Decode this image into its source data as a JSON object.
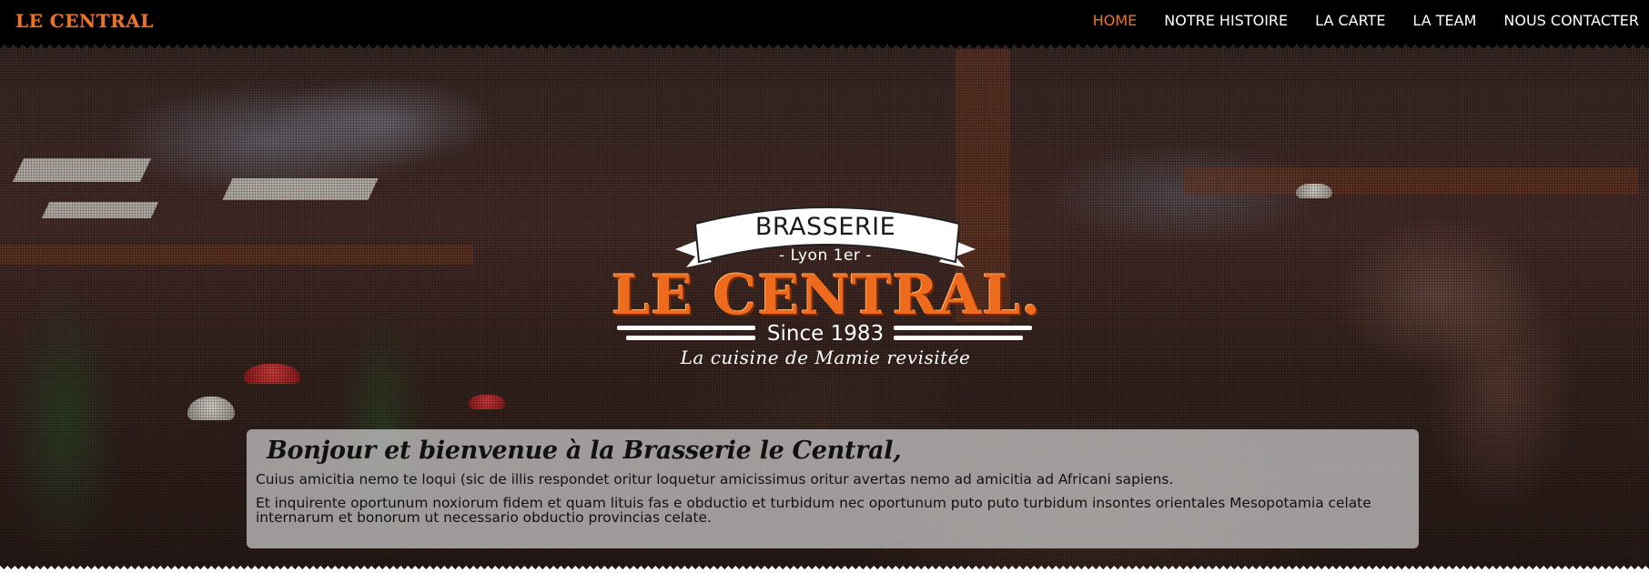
{
  "brand": {
    "logo_text": "LE CENTRAL"
  },
  "nav": {
    "items": [
      {
        "label": "HOME",
        "active": true
      },
      {
        "label": "NOTRE HISTOIRE",
        "active": false
      },
      {
        "label": "LA CARTE",
        "active": false
      },
      {
        "label": "LA TEAM",
        "active": false
      },
      {
        "label": "NOUS CONTACTER",
        "active": false
      }
    ]
  },
  "logo": {
    "ribbon_text": "BRASSERIE",
    "city": "- Lyon 1er -",
    "name": "LE CENTRAL.",
    "since": "Since 1983",
    "tagline": "La cuisine de Mamie revisitée"
  },
  "welcome": {
    "title": "Bonjour et bienvenue à la Brasserie le Central,",
    "paragraphs": [
      "Cuius amicitia nemo te loqui (sic de illis respondet oritur loquetur amicissimus oritur avertas nemo ad amicitia ad Africani sapiens.",
      "Et inquirente oportunum noxiorum fidem et quam lituis fas e obductio et turbidum nec oportunum puto puto turbidum insontes orientales Mesopotamia celate internarum et bonorum ut necessario obductio provincias celate."
    ]
  },
  "colors": {
    "accent": "#e8742a",
    "nav_bg": "#000000",
    "text_light": "#ffffff"
  }
}
